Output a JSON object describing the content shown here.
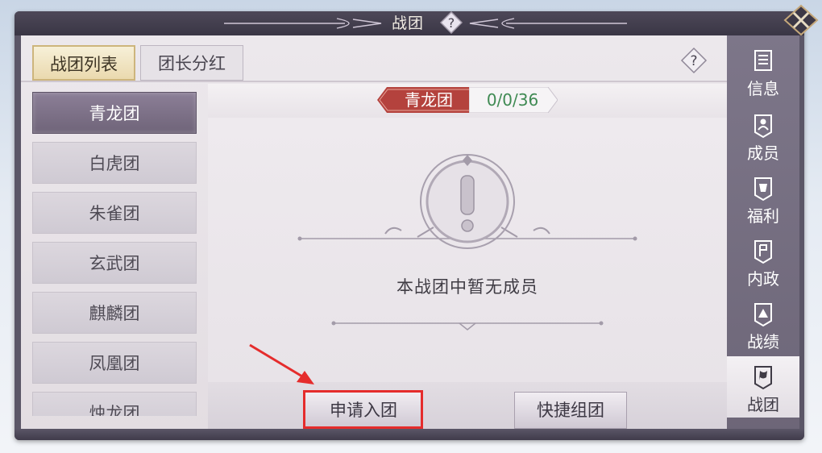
{
  "window": {
    "title": "战团",
    "help_icon": "question-icon",
    "close_icon": "close-x-icon"
  },
  "tabs": [
    {
      "label": "战团列表",
      "active": true
    },
    {
      "label": "团长分红",
      "active": false
    }
  ],
  "tabs_help_icon": "question-diamond-icon",
  "team_list": [
    {
      "name": "青龙团",
      "selected": true
    },
    {
      "name": "白虎团",
      "selected": false
    },
    {
      "name": "朱雀团",
      "selected": false
    },
    {
      "name": "玄武团",
      "selected": false
    },
    {
      "name": "麒麟团",
      "selected": false
    },
    {
      "name": "凤凰团",
      "selected": false
    },
    {
      "name": "烛龙团",
      "selected": false
    }
  ],
  "current_team": {
    "name": "青龙团",
    "count": "0/0/36"
  },
  "empty_state": {
    "icon": "exclamation-icon",
    "message": "本战团中暂无成员"
  },
  "buttons": {
    "apply": "申请入团",
    "quick": "快捷组团"
  },
  "right_nav": [
    {
      "label": "信息",
      "icon": "scroll-icon",
      "active": false
    },
    {
      "label": "成员",
      "icon": "members-icon",
      "active": false
    },
    {
      "label": "福利",
      "icon": "gift-icon",
      "active": false
    },
    {
      "label": "内政",
      "icon": "flag-icon",
      "active": false
    },
    {
      "label": "战绩",
      "icon": "medal-icon",
      "active": false
    },
    {
      "label": "战团",
      "icon": "banner-icon",
      "active": true
    }
  ],
  "colors": {
    "highlight": "#e52c2c",
    "count_text": "#3f8a53",
    "ribbon": "#b4423d"
  }
}
